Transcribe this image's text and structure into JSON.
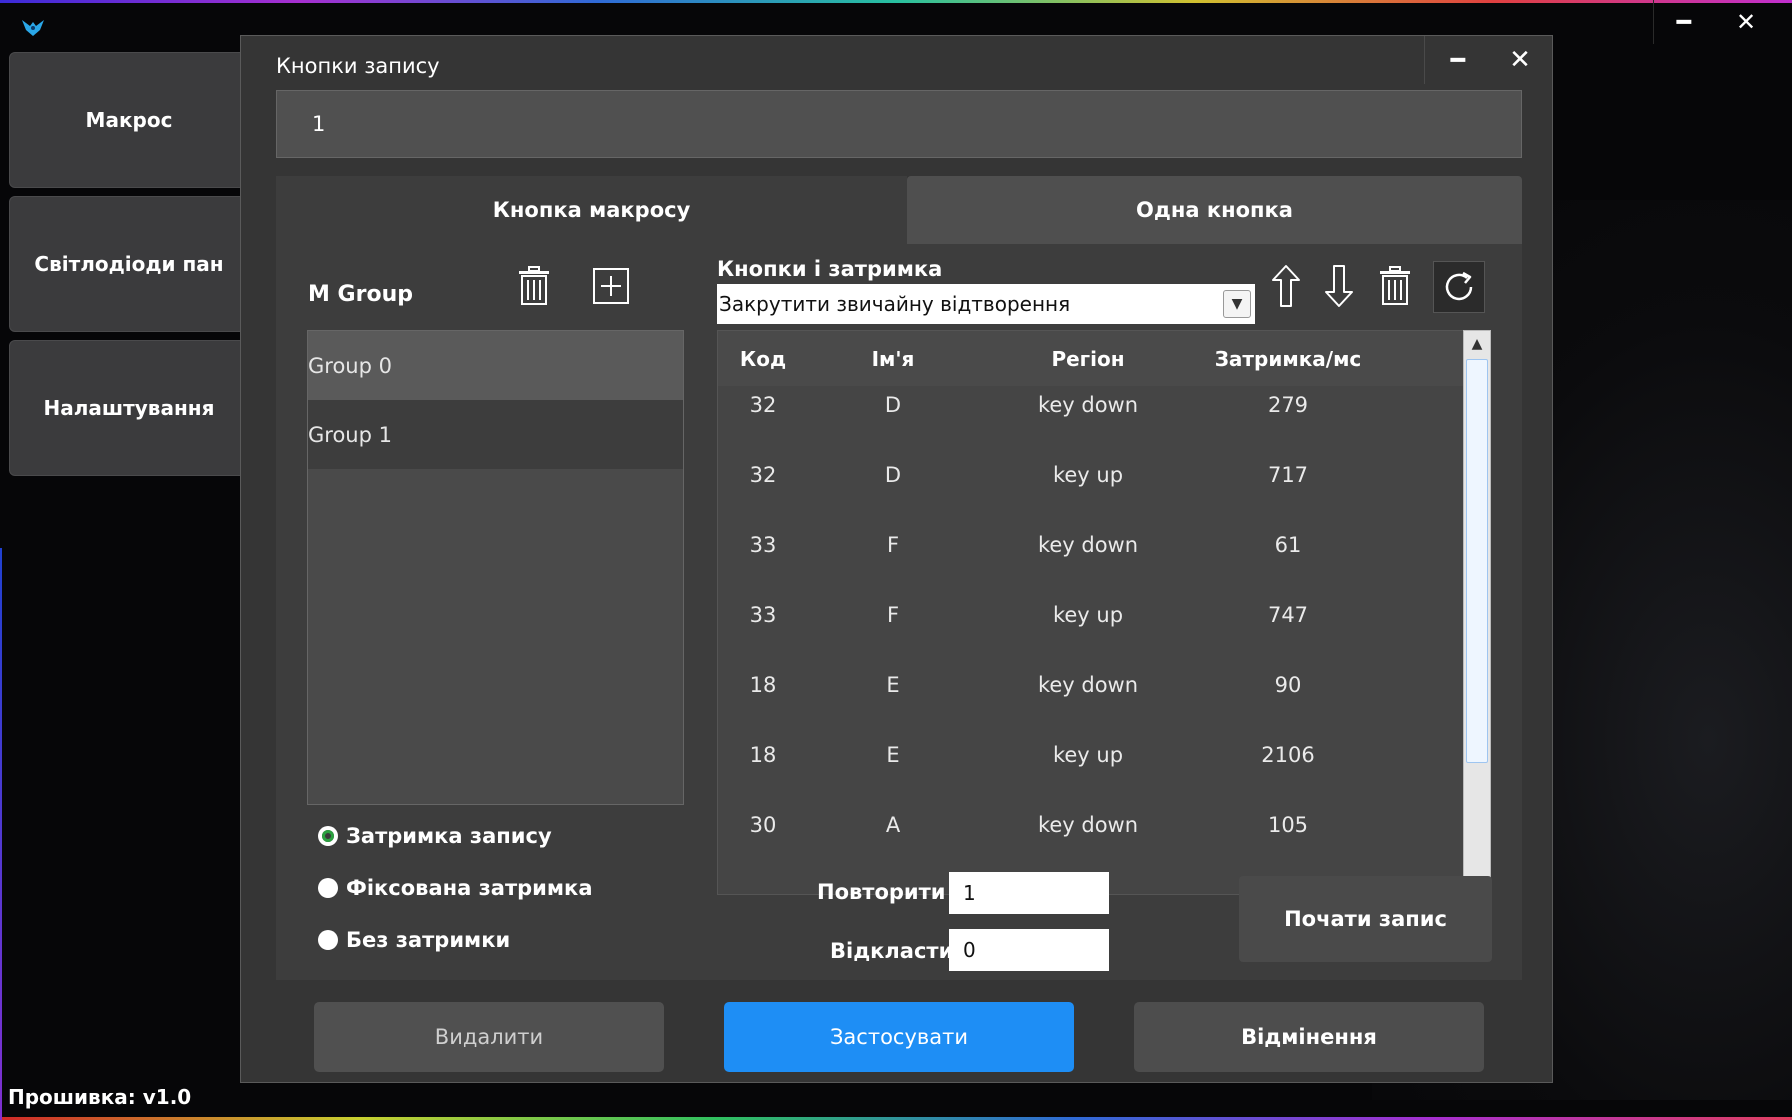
{
  "window": {
    "minimize_glyph": "━",
    "close_glyph": "✕",
    "firmware": "Прошивка: v1.0"
  },
  "sidebar": {
    "items": [
      {
        "label": "Макрос"
      },
      {
        "label": "Світлодіоди пан"
      },
      {
        "label": "Налаштування"
      }
    ]
  },
  "dialog": {
    "title": "Кнопки запису",
    "name_value": "1",
    "tabs": [
      {
        "label": "Кнопка макросу",
        "active": true
      },
      {
        "label": "Одна кнопка",
        "active": false
      }
    ],
    "groups": {
      "label": "M Group",
      "items": [
        "Group 0",
        "Group 1"
      ]
    },
    "delay_options": [
      {
        "label": "Затримка запису",
        "checked": true
      },
      {
        "label": "Фіксована затримка",
        "checked": false
      },
      {
        "label": "Без затримки",
        "checked": false
      }
    ],
    "keys": {
      "label": "Кнопки і затримка",
      "mode": "Закрутити звичайну відтворення",
      "columns": [
        "Код",
        "Ім'я",
        "Регіон",
        "Затримка/мс"
      ],
      "rows": [
        [
          "32",
          "D",
          "key down",
          "279"
        ],
        [
          "32",
          "D",
          "key up",
          "717"
        ],
        [
          "33",
          "F",
          "key down",
          "61"
        ],
        [
          "33",
          "F",
          "key up",
          "747"
        ],
        [
          "18",
          "E",
          "key down",
          "90"
        ],
        [
          "18",
          "E",
          "key up",
          "2106"
        ],
        [
          "30",
          "A",
          "key down",
          "105"
        ]
      ]
    },
    "repeat_label": "Повторити",
    "repeat_value": "1",
    "defer_label": "Відкласти",
    "defer_value": "0",
    "record_button": "Почати запис",
    "buttons": {
      "delete": "Видалити",
      "apply": "Застосувати",
      "cancel": "Відмінення"
    },
    "colors": {
      "apply": "#1e8ef5",
      "radio_checked": "#2ca040"
    }
  }
}
